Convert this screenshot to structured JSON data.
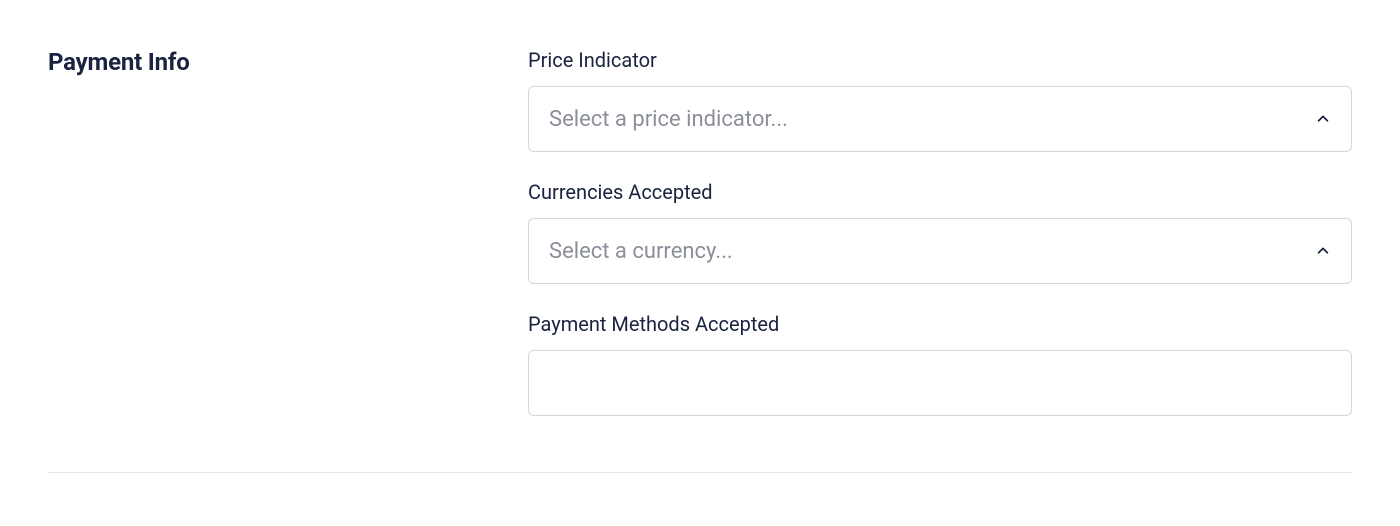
{
  "section": {
    "title": "Payment Info"
  },
  "fields": {
    "priceIndicator": {
      "label": "Price Indicator",
      "placeholder": "Select a price indicator..."
    },
    "currenciesAccepted": {
      "label": "Currencies Accepted",
      "placeholder": "Select a currency..."
    },
    "paymentMethods": {
      "label": "Payment Methods Accepted",
      "value": ""
    }
  }
}
